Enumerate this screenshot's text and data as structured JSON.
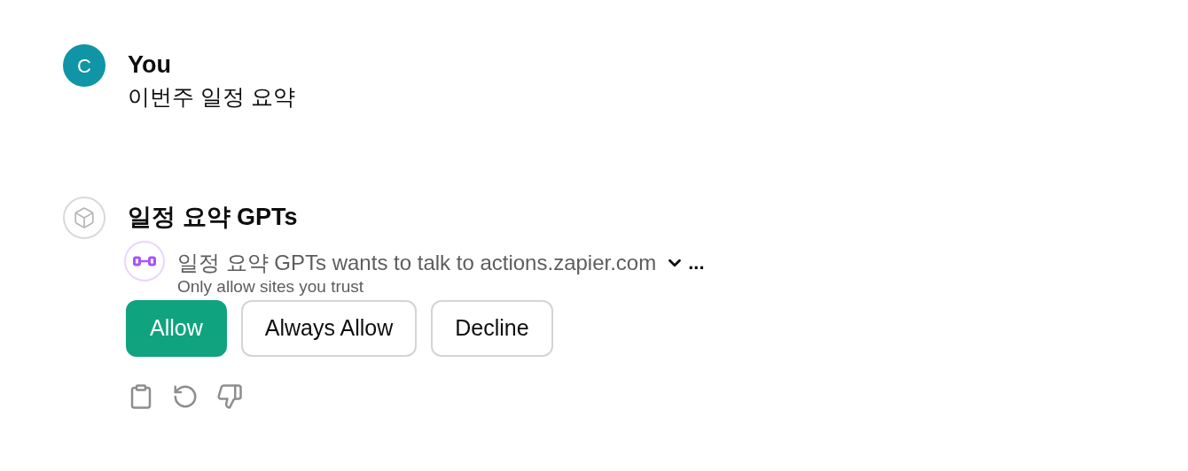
{
  "user_message": {
    "avatar_letter": "C",
    "author": "You",
    "text": "이번주 일정 요약"
  },
  "assistant_message": {
    "author": "일정 요약 GPTs",
    "action_request": {
      "text": "일정 요약 GPTs wants to talk to actions.zapier.com",
      "more": "...",
      "note": "Only allow sites you trust",
      "buttons": [
        {
          "label": "Allow",
          "kind": "primary"
        },
        {
          "label": "Always Allow",
          "kind": "secondary"
        },
        {
          "label": "Decline",
          "kind": "secondary"
        }
      ]
    }
  }
}
